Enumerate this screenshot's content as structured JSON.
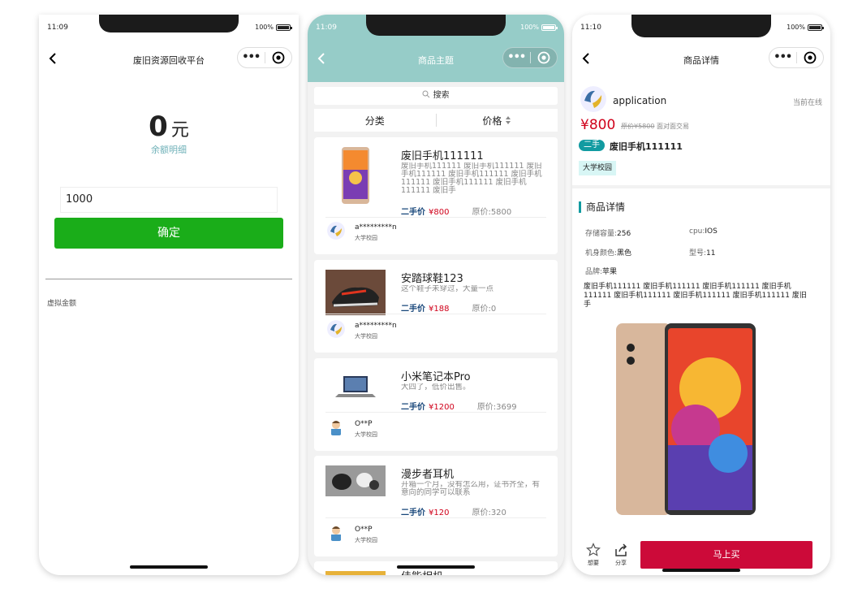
{
  "screens": {
    "recharge": {
      "status": {
        "time": "11:09",
        "battery": "100%"
      },
      "title": "废旧资源回收平台",
      "balance_value": "0",
      "balance_unit": "元",
      "balance_detail": "余额明细",
      "amount_input": "1000",
      "confirm_label": "确定",
      "virtual_amount_label": "虚拟金额"
    },
    "list": {
      "status": {
        "time": "11:09",
        "battery": "100%"
      },
      "title": "商品主题",
      "search_label": "搜索",
      "sort": {
        "category": "分类",
        "price": "价格"
      },
      "items": [
        {
          "title": "废旧手机111111",
          "desc": "废旧手机111111 废旧手机111111 废旧手机111111 废旧手机111111 废旧手机111111 废旧手机111111 废旧手机111111 废旧手",
          "price_label": "二手价",
          "price": "¥800",
          "original": "原价:5800",
          "user": "a*********n",
          "school": "大学校园"
        },
        {
          "title": "安踏球鞋123",
          "desc": "这个鞋子未穿过，大量一点",
          "price_label": "二手价",
          "price": "¥188",
          "original": "原价:0",
          "user": "a*********n",
          "school": "大学校园"
        },
        {
          "title": "小米笔记本Pro",
          "desc": "大四了，低价出售。",
          "price_label": "二手价",
          "price": "¥1200",
          "original": "原价:3699",
          "user": "O**P",
          "school": "大学校园"
        },
        {
          "title": "漫步者耳机",
          "desc": "开箱一个月，没有怎么用，证书齐全，有意向的同学可以联系",
          "price_label": "二手价",
          "price": "¥120",
          "original": "原价:320",
          "user": "O**P",
          "school": "大学校园"
        },
        {
          "title": "佳能相机",
          "desc": "",
          "price_label": "",
          "price": "",
          "original": "",
          "user": "",
          "school": ""
        }
      ]
    },
    "detail": {
      "status": {
        "time": "11:10",
        "battery": "100%"
      },
      "title": "商品详情",
      "user": "application",
      "online": "当前在线",
      "price": "¥800",
      "original_label": "原价",
      "original_value": "¥5800",
      "trade_type": "面对面交易",
      "tag": "二手",
      "name": "废旧手机111111",
      "campus": "大学校园",
      "section_title": "商品详情",
      "attrs": {
        "storage_label": "存储容量:",
        "storage": "256",
        "cpu_label": "cpu:",
        "cpu": "IOS",
        "color_label": "机身颜色:",
        "color": "黑色",
        "model_label": "型号:",
        "model": "11",
        "brand_label": "品牌:",
        "brand": "苹果"
      },
      "description": "废旧手机111111 废旧手机111111 废旧手机111111 废旧手机111111 废旧手机111111 废旧手机111111 废旧手机111111 废旧手",
      "want_label": "想要",
      "share_label": "分享",
      "buy_label": "马上买"
    }
  },
  "colors": {
    "wechat_green": "#1aad19",
    "teal_header": "#96ccc8",
    "accent_teal": "#129ba1",
    "price_red": "#d0021b",
    "buy_red": "#cc0a39"
  }
}
